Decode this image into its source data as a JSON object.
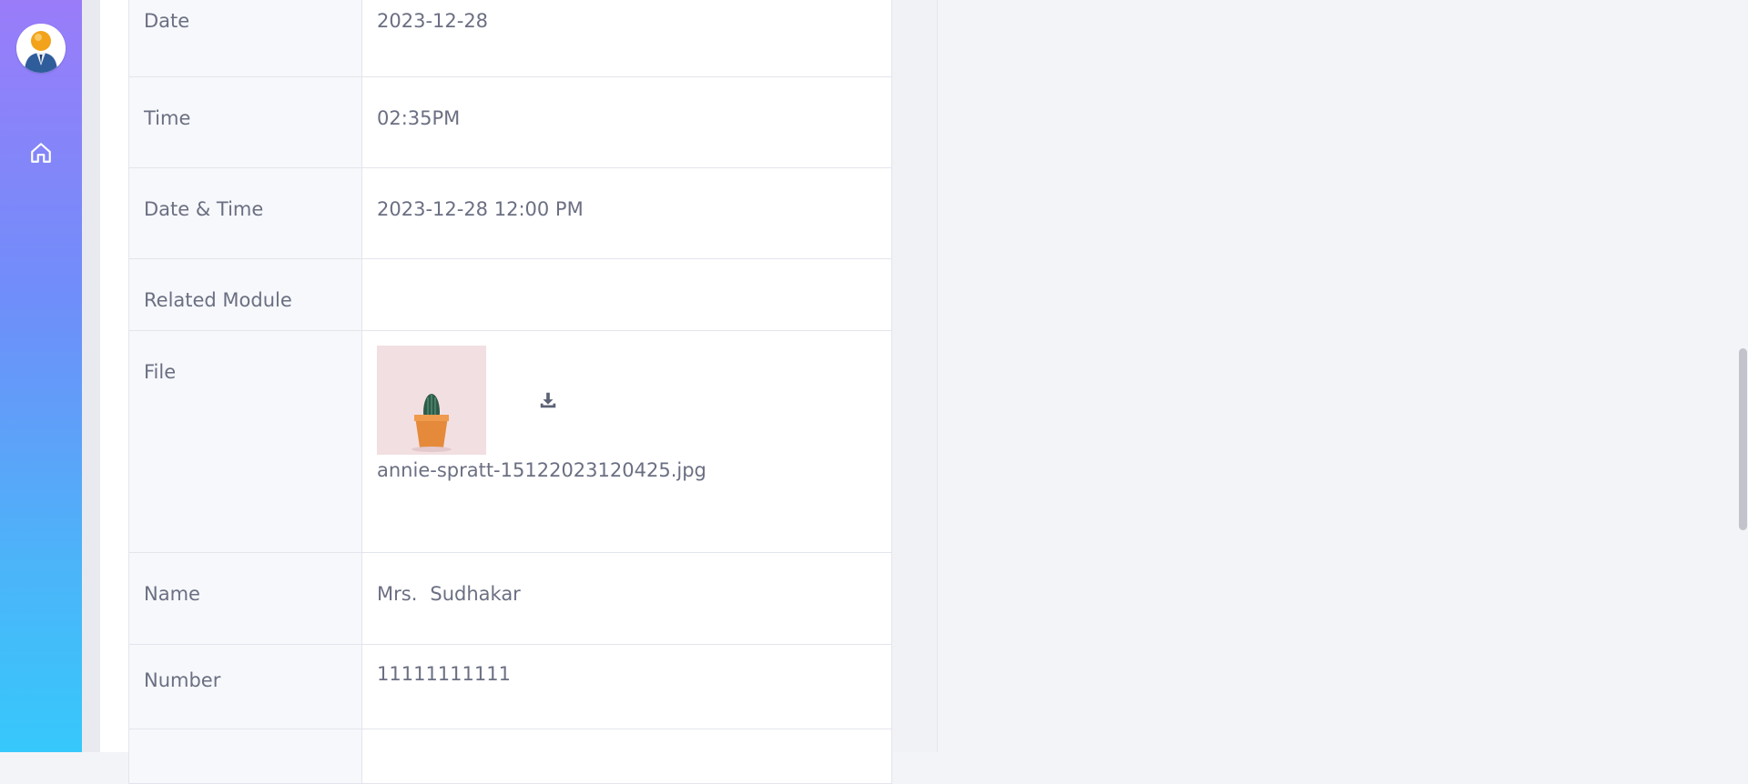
{
  "sidebar": {
    "avatar_icon": "user-avatar-icon",
    "home_icon": "home-icon"
  },
  "details": {
    "rows": [
      {
        "label": "Date",
        "value": "2023-12-28"
      },
      {
        "label": "Time",
        "value": "02:35PM"
      },
      {
        "label": "Date & Time",
        "value": "2023-12-28 12:00 PM"
      },
      {
        "label": "Related Module",
        "value": ""
      },
      {
        "label": "File",
        "file_name": "annie-spratt-15122023120425.jpg",
        "download_icon": "download-icon"
      },
      {
        "label": "Name",
        "salutation": "Mrs.",
        "value": "Sudhakar"
      },
      {
        "label": "Number",
        "value": "11111111111"
      }
    ]
  },
  "colors": {
    "sidebar_top": "#9a7cf9",
    "sidebar_bottom": "#36c8fb",
    "text": "#6b6f82",
    "label_bg": "#f7f8fb",
    "border": "#e3e5ec"
  }
}
